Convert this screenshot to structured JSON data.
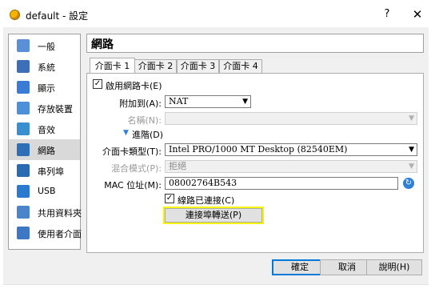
{
  "window": {
    "title": "default - 設定",
    "help_label": "?",
    "close_label": "✕"
  },
  "sidebar": {
    "items": [
      {
        "label": "一般",
        "icon": "general-icon",
        "color": "#5b8fd6"
      },
      {
        "label": "系統",
        "icon": "system-icon",
        "color": "#3d6fb8"
      },
      {
        "label": "顯示",
        "icon": "display-icon",
        "color": "#3a7bd5"
      },
      {
        "label": "存放裝置",
        "icon": "storage-icon",
        "color": "#4d8fd9"
      },
      {
        "label": "音效",
        "icon": "audio-icon",
        "color": "#3a8fd0"
      },
      {
        "label": "網路",
        "icon": "network-icon",
        "color": "#2f6fb8"
      },
      {
        "label": "串列埠",
        "icon": "serial-port-icon",
        "color": "#2a6ab0"
      },
      {
        "label": "USB",
        "icon": "usb-icon",
        "color": "#2a7ad0"
      },
      {
        "label": "共用資料夾",
        "icon": "shared-folder-icon",
        "color": "#4a85c9"
      },
      {
        "label": "使用者介面",
        "icon": "user-interface-icon",
        "color": "#3e78c4"
      }
    ],
    "selected": "網路"
  },
  "header": {
    "title": "網路"
  },
  "tabs": [
    {
      "label": "介面卡 1",
      "active": true
    },
    {
      "label": "介面卡 2",
      "active": false
    },
    {
      "label": "介面卡 3",
      "active": false
    },
    {
      "label": "介面卡 4",
      "active": false
    }
  ],
  "adapter": {
    "enable_label": "啟用網路卡(E)",
    "enable_checked": true,
    "attached_label": "附加到(A):",
    "attached_value": "NAT",
    "name_label": "名稱(N):",
    "name_value": "",
    "advanced_label": "進階(D)",
    "type_label": "介面卡類型(T):",
    "type_value": "Intel PRO/1000 MT Desktop (82540EM)",
    "promiscuous_label": "混合模式(P):",
    "promiscuous_value": "拒絕",
    "mac_label": "MAC 位址(M):",
    "mac_value": "08002764B543",
    "cable_label": "線路已連接(C)",
    "cable_checked": true,
    "port_forwarding_label": "連接埠轉送(P)"
  },
  "buttons": {
    "ok": "確定",
    "cancel": "取消",
    "help": "說明(H)"
  },
  "colors": {
    "highlight": "#f5f500",
    "default_button_border": "#0078d7"
  }
}
